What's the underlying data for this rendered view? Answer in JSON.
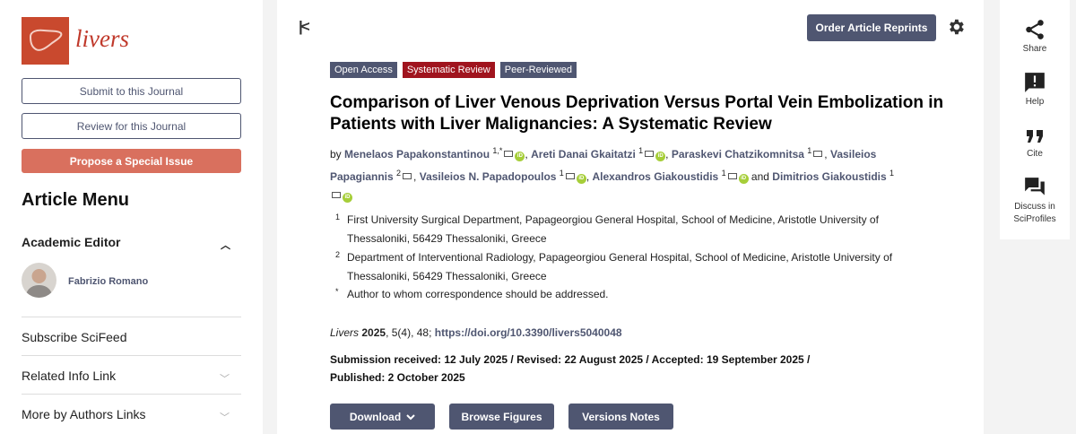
{
  "sidebar": {
    "logo_text": "livers",
    "submit_label": "Submit to this Journal",
    "review_label": "Review for this Journal",
    "propose_label": "Propose a Special Issue",
    "menu_title": "Article Menu",
    "academic_editor_label": "Academic Editor",
    "editor_name": "Fabrizio Romano",
    "subscribe_label": "Subscribe SciFeed",
    "related_label": "Related Info Link",
    "more_label": "More by Authors Links"
  },
  "header": {
    "reprints_label": "Order Article Reprints"
  },
  "article": {
    "tags": [
      "Open Access",
      "Systematic Review",
      "Peer-Reviewed"
    ],
    "title": "Comparison of Liver Venous Deprivation Versus Portal Vein Embolization in Patients with Liver Malignancies: A Systematic Review",
    "by": "by",
    "and": "and",
    "authors": [
      {
        "name": "Menelaos Papakonstantinou",
        "sup": "1,*",
        "orcid": true
      },
      {
        "name": "Areti Danai Gkaitatzi",
        "sup": "1",
        "orcid": true
      },
      {
        "name": "Paraskevi Chatzikomnitsa",
        "sup": "1",
        "orcid": false
      },
      {
        "name": "Vasileios Papagiannis",
        "sup": "2",
        "orcid": false
      },
      {
        "name": "Vasileios N. Papadopoulos",
        "sup": "1",
        "orcid": true
      },
      {
        "name": "Alexandros Giakoustidis",
        "sup": "1",
        "orcid": true
      },
      {
        "name": "Dimitrios Giakoustidis",
        "sup": "1",
        "orcid": true
      }
    ],
    "affiliations": [
      {
        "num": "1",
        "text": "First University Surgical Department, Papageorgiou General Hospital, School of Medicine, Aristotle University of Thessaloniki, 56429 Thessaloniki, Greece"
      },
      {
        "num": "2",
        "text": "Department of Interventional Radiology, Papageorgiou General Hospital, School of Medicine, Aristotle University of Thessaloniki, 56429 Thessaloniki, Greece"
      },
      {
        "num": "*",
        "text": "Author to whom correspondence should be addressed."
      }
    ],
    "citation": {
      "journal": "Livers",
      "year": "2025",
      "rest": ", 5(4), 48; ",
      "doi": "https://doi.org/10.3390/livers5040048"
    },
    "dates": "Submission received: 12 July 2025 / Revised: 22 August 2025 / Accepted: 19 September 2025 / Published: 2 October 2025",
    "actions": {
      "download": "Download",
      "browse": "Browse Figures",
      "versions": "Versions Notes"
    }
  },
  "rail": {
    "share": "Share",
    "help": "Help",
    "cite": "Cite",
    "discuss_line1": "Discuss in",
    "discuss_line2": "SciProfiles"
  },
  "colors": {
    "brand": "#4f5671",
    "accent": "#d9705e",
    "tag_review": "#a0141e",
    "orcid": "#a6ce39"
  }
}
